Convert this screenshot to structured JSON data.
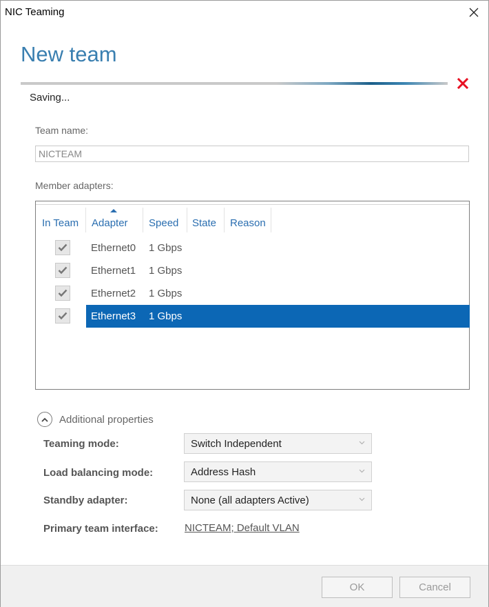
{
  "window": {
    "title": "NIC Teaming"
  },
  "page": {
    "heading": "New team"
  },
  "progress": {
    "status": "Saving...",
    "indeterminate": true
  },
  "team_name": {
    "label": "Team name:",
    "value": "NICTEAM"
  },
  "member_adapters": {
    "label": "Member adapters:",
    "columns": [
      "In Team",
      "Adapter",
      "Speed",
      "State",
      "Reason"
    ],
    "sorted_column": "Adapter",
    "rows": [
      {
        "in_team": true,
        "adapter": "Ethernet0",
        "speed": "1 Gbps",
        "state": "",
        "reason": "",
        "selected": false
      },
      {
        "in_team": true,
        "adapter": "Ethernet1",
        "speed": "1 Gbps",
        "state": "",
        "reason": "",
        "selected": false
      },
      {
        "in_team": true,
        "adapter": "Ethernet2",
        "speed": "1 Gbps",
        "state": "",
        "reason": "",
        "selected": false
      },
      {
        "in_team": true,
        "adapter": "Ethernet3",
        "speed": "1 Gbps",
        "state": "",
        "reason": "",
        "selected": true
      }
    ]
  },
  "additional_properties": {
    "label": "Additional properties",
    "expanded": true,
    "teaming_mode": {
      "label": "Teaming mode:",
      "value": "Switch Independent"
    },
    "load_balancing_mode": {
      "label": "Load balancing mode:",
      "value": "Address Hash"
    },
    "standby_adapter": {
      "label": "Standby adapter:",
      "value": "None (all adapters Active)"
    },
    "primary_interface": {
      "label": "Primary team interface:",
      "value": "NICTEAM; Default VLAN"
    }
  },
  "buttons": {
    "ok": "OK",
    "cancel": "Cancel"
  },
  "icons": {
    "close": "close-icon",
    "cancel_operation": "red-x-icon",
    "checkbox": "checkmark-icon",
    "expander": "chevron-up-icon",
    "dropdown": "chevron-down-icon"
  },
  "colors": {
    "heading": "#3a7fb0",
    "column_header": "#2a6eb0",
    "selection": "#0c67b5",
    "cancel_x": "#e81123"
  }
}
